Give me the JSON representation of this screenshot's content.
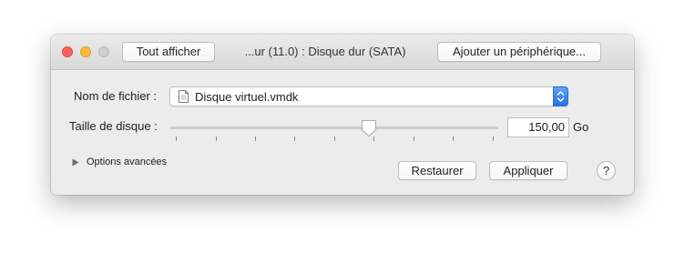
{
  "window": {
    "title": "...ur (11.0) : Disque dur (SATA)"
  },
  "toolbar": {
    "show_all_label": "Tout afficher",
    "add_device_label": "Ajouter un périphérique..."
  },
  "form": {
    "file_name_label": "Nom de fichier :",
    "file_name_value": "Disque virtuel.vmdk",
    "file_icon": "document-icon",
    "disk_size_label": "Taille de disque :",
    "disk_size_value": "150,00",
    "disk_size_unit": "Go",
    "slider_fraction": 0.6
  },
  "advanced": {
    "label": "Options avancées"
  },
  "actions": {
    "restore_label": "Restaurer",
    "apply_label": "Appliquer",
    "help_label": "?"
  },
  "colors": {
    "close": "#fc605c",
    "minimize": "#fdbc40",
    "zoom": "#cfcfcf",
    "popup_accent": "#2a6fe0"
  }
}
